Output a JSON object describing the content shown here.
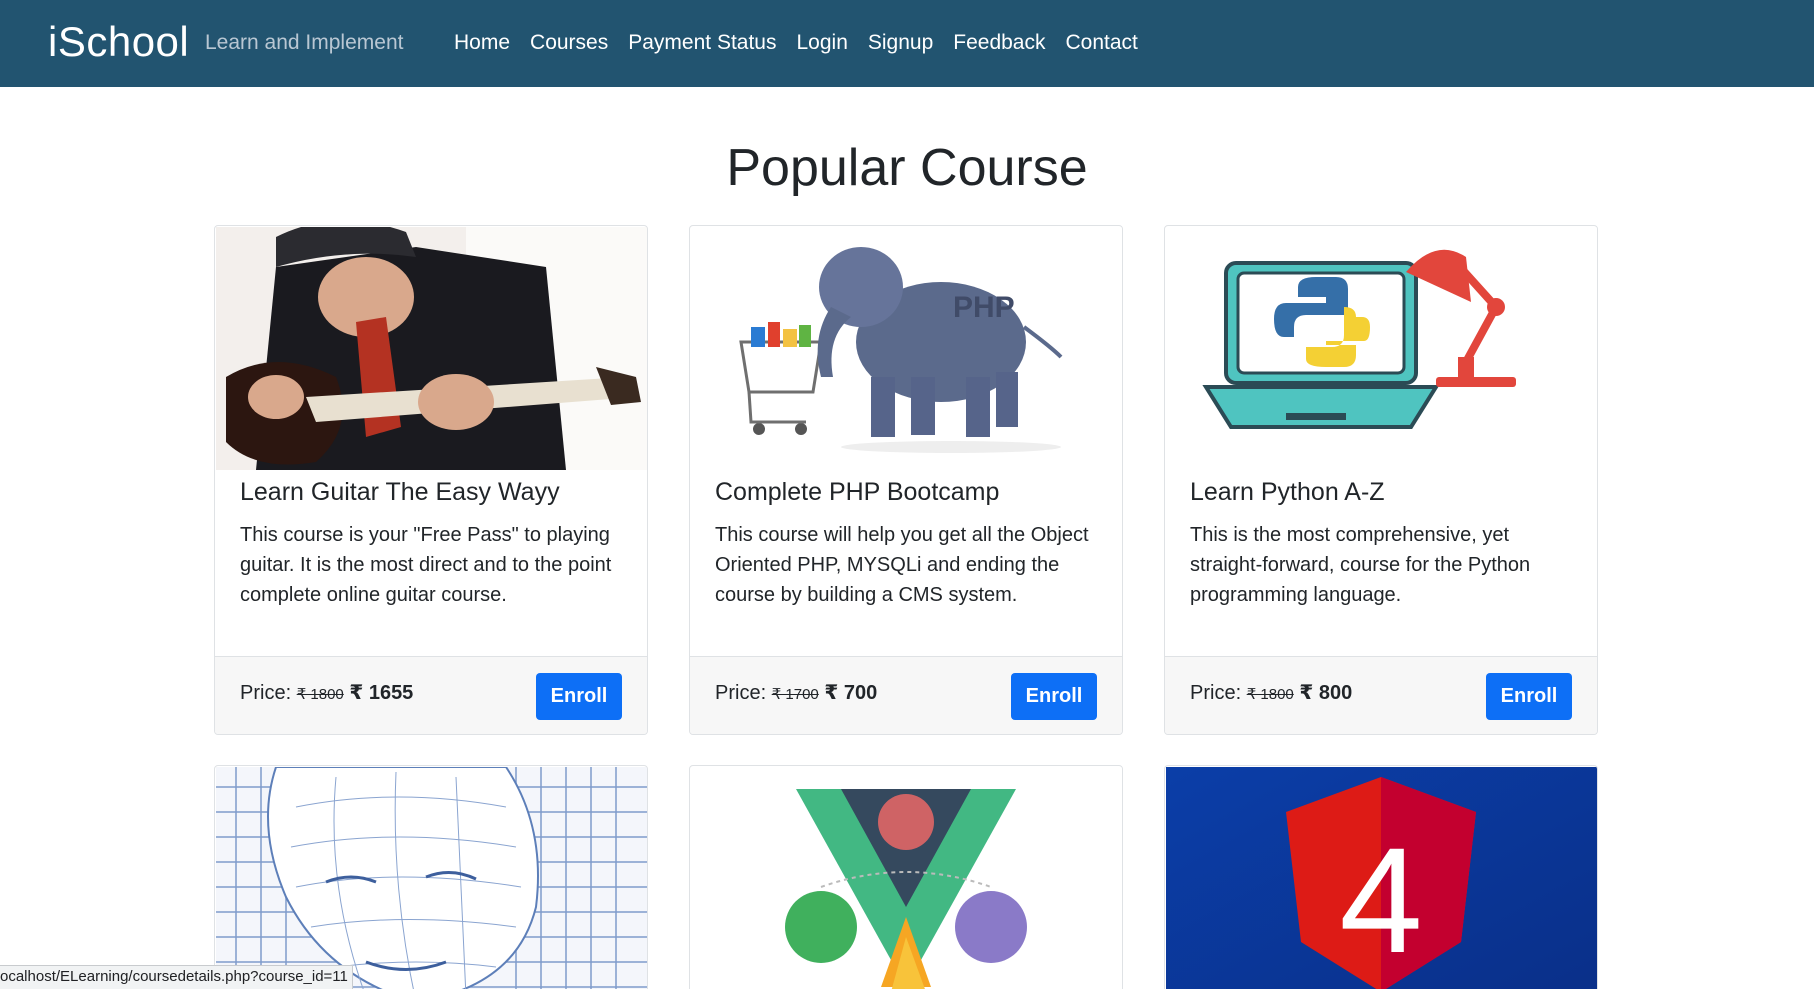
{
  "navbar": {
    "brand": "iSchool",
    "tagline": "Learn and Implement",
    "links": [
      "Home",
      "Courses",
      "Payment Status",
      "Login",
      "Signup",
      "Feedback",
      "Contact"
    ]
  },
  "page_title": "Popular Course",
  "price_label": "Price:",
  "enroll_label": "Enroll",
  "courses": [
    {
      "title": "Learn Guitar The Easy Wayy",
      "description": "This course is your \"Free Pass\" to playing guitar. It is the most direct and to the point complete online guitar course.",
      "old_price": "₹ 1800",
      "new_price": "₹ 1655",
      "image": "guitar-player-image"
    },
    {
      "title": "Complete PHP Bootcamp",
      "description": "This course will help you get all the Object Oriented PHP, MYSQLi and ending the course by building a CMS system.",
      "old_price": "₹ 1700",
      "new_price": "₹ 700",
      "image": "php-elephant-image",
      "image_text": "PHP"
    },
    {
      "title": "Learn Python A-Z",
      "description": "This is the most comprehensive, yet straight-forward, course for the Python programming language.",
      "old_price": "₹ 1800",
      "new_price": "₹ 800",
      "image": "python-laptop-image"
    },
    {
      "image": "wireframe-face-image"
    },
    {
      "image": "vue-firebase-image"
    },
    {
      "image": "angular-4-image",
      "image_text": "4"
    }
  ],
  "status_bar": "ocalhost/ELearning/coursedetails.php?course_id=11",
  "colors": {
    "navbar_bg": "#225470",
    "button_bg": "#0d6ff6",
    "footer_bg": "#f7f7f7"
  }
}
